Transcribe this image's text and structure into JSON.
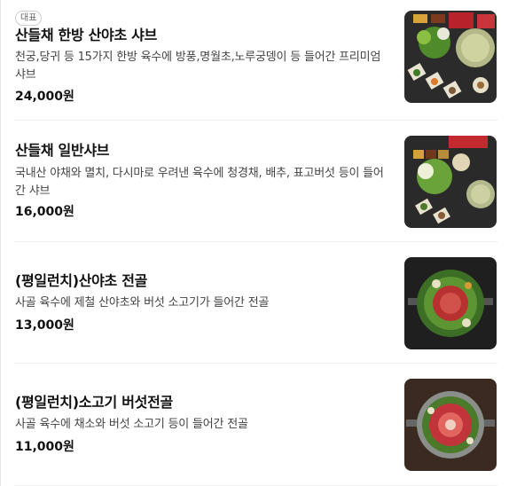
{
  "items": [
    {
      "badge": "대표",
      "name": "산들채 한방 산야초 샤브",
      "description": "천궁,당귀 등 15가지 한방 육수에 방풍,명월초,노루궁뎅이 등 들어간 프리미엄 샤브",
      "price": "24,000원",
      "image_icon": "shabu-platter-photo"
    },
    {
      "name": "산들채 일반샤브",
      "description": "국내산 야채와 멸치, 다시마로 우려낸 육수에 청경채, 배추, 표고버섯 등이 들어간 샤브",
      "price": "16,000원",
      "image_icon": "shabu-platter-photo"
    },
    {
      "name": "(평일런치)산야초 전골",
      "description": "사골 육수에 제철 산야초와 버섯 소고기가 들어간 전골",
      "price": "13,000원",
      "image_icon": "hotpot-photo"
    },
    {
      "name": "(평일런치)소고기 버섯전골",
      "description": "사골 육수에 채소와 버섯 소고기 등이 들어간 전골",
      "price": "11,000원",
      "image_icon": "hotpot-photo"
    }
  ]
}
